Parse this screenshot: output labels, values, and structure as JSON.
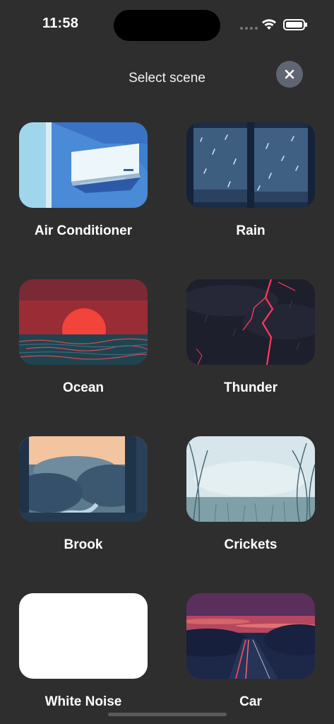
{
  "status": {
    "time": "11:58",
    "icons": [
      "signal-dots-icon",
      "wifi-icon",
      "battery-icon"
    ]
  },
  "header": {
    "title": "Select scene",
    "close_icon": "close-icon"
  },
  "scenes": [
    {
      "label": "Air Conditioner"
    },
    {
      "label": "Rain"
    },
    {
      "label": "Ocean"
    },
    {
      "label": "Thunder"
    },
    {
      "label": "Brook"
    },
    {
      "label": "Crickets"
    },
    {
      "label": "White Noise"
    },
    {
      "label": "Car"
    }
  ],
  "colors": {
    "background": "#2e2e2e",
    "close_button": "#5f6572",
    "text": "#ffffff"
  }
}
